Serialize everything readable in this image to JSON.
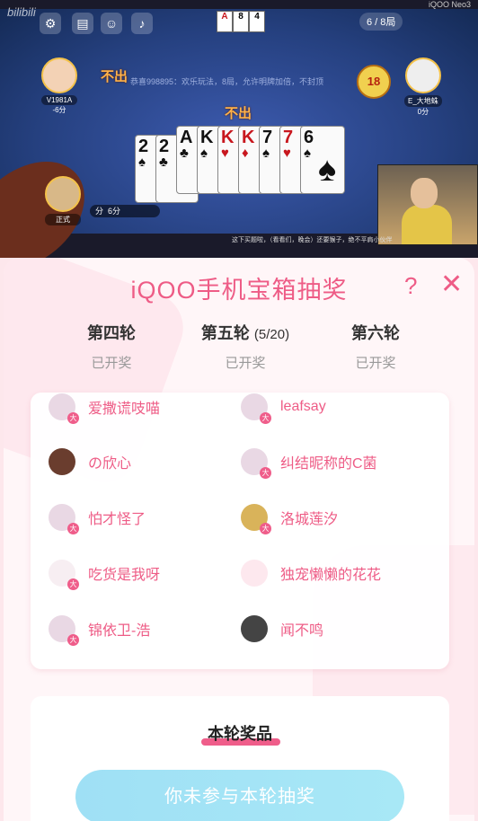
{
  "video": {
    "watermark": "bilibili",
    "brand": "iQOO Neo3",
    "round_counter": "6 / 8局",
    "mini_cards": [
      "A",
      "8",
      "4"
    ],
    "left_player": {
      "name": "V1981A",
      "score": "-6分"
    },
    "right_player": {
      "name": "E_大地蛛",
      "score": "0分"
    },
    "bottom_player": {
      "name": "正式"
    },
    "pass_left": "不出",
    "pass_center": "不出",
    "clock": "18",
    "notice": "恭喜998895：欢乐玩法，8局，允许明牌加倍，不封顶",
    "score_label": "分",
    "score_value": "6分",
    "cards": [
      {
        "rank": "2",
        "suit": "♠",
        "color": "black"
      },
      {
        "rank": "2",
        "suit": "♣",
        "color": "black"
      },
      {
        "rank": "A",
        "suit": "♣",
        "color": "black"
      },
      {
        "rank": "K",
        "suit": "♠",
        "color": "black"
      },
      {
        "rank": "K",
        "suit": "♥",
        "color": "red"
      },
      {
        "rank": "K",
        "suit": "♦",
        "color": "red"
      },
      {
        "rank": "7",
        "suit": "♠",
        "color": "black"
      },
      {
        "rank": "7",
        "suit": "♥",
        "color": "red"
      },
      {
        "rank": "6",
        "suit": "♠",
        "color": "black"
      }
    ],
    "subtitle": "这下买题啦，（看看们，晚会）还要猴子，绝不平肩小伙伴"
  },
  "panel": {
    "title": "iQOO手机宝箱抽奖",
    "help_icon": "?",
    "close_icon": "✕",
    "tabs": [
      {
        "label": "第四轮",
        "progress": "",
        "status": "已开奖",
        "active": false
      },
      {
        "label": "第五轮",
        "progress": "(5/20)",
        "status": "已开奖",
        "active": true
      },
      {
        "label": "第六轮",
        "progress": "",
        "status": "已开奖",
        "active": false
      }
    ],
    "winners": [
      {
        "name": "爱撒谎吱喵"
      },
      {
        "name": "leafsay"
      },
      {
        "name": "の欣心"
      },
      {
        "name": "纠结昵称的C菌"
      },
      {
        "name": "怕才怪了"
      },
      {
        "name": "洛城莲汐"
      },
      {
        "name": "吃货是我呀"
      },
      {
        "name": "独宠懒懒的花花"
      },
      {
        "name": "锦依卫-浩"
      },
      {
        "name": "闻不鸣"
      }
    ],
    "badge_char": "大",
    "prize_title": "本轮奖品",
    "cta": "你未参与本轮抽奖"
  }
}
